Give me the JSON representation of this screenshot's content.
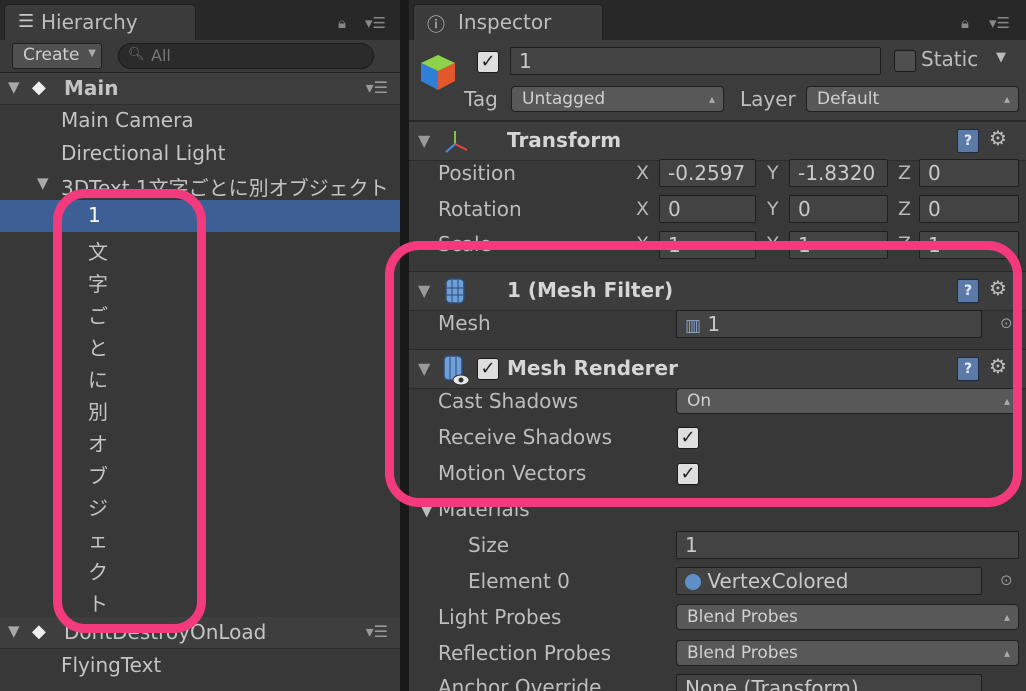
{
  "hierarchy": {
    "tab_label": "Hierarchy",
    "create_label": "Create",
    "search_placeholder": "All",
    "rows": [
      {
        "label": "Main"
      },
      {
        "label": "Main Camera"
      },
      {
        "label": "Directional Light"
      },
      {
        "label": "3DText 1文字ごとに別オブジェクト"
      },
      {
        "label": "1"
      },
      {
        "label": "文"
      },
      {
        "label": "字"
      },
      {
        "label": "ご"
      },
      {
        "label": "と"
      },
      {
        "label": "に"
      },
      {
        "label": "別"
      },
      {
        "label": "オ"
      },
      {
        "label": "ブ"
      },
      {
        "label": "ジ"
      },
      {
        "label": "ェ"
      },
      {
        "label": "ク"
      },
      {
        "label": "ト"
      },
      {
        "label": "DontDestroyOnLoad"
      },
      {
        "label": "FlyingText"
      }
    ]
  },
  "inspector": {
    "tab_label": "Inspector",
    "object_name": "1",
    "static_label": "Static",
    "tag_label": "Tag",
    "tag_value": "Untagged",
    "layer_label": "Layer",
    "layer_value": "Default",
    "transform": {
      "title": "Transform",
      "position_label": "Position",
      "rotation_label": "Rotation",
      "scale_label": "Scale",
      "position": {
        "x": "-0.2597",
        "y": "-1.8320",
        "z": "0"
      },
      "rotation": {
        "x": "0",
        "y": "0",
        "z": "0"
      },
      "scale": {
        "x": "1",
        "y": "1",
        "z": "1"
      }
    },
    "mesh_filter": {
      "title": "1 (Mesh Filter)",
      "mesh_label": "Mesh",
      "mesh_value": "1"
    },
    "mesh_renderer": {
      "title": "Mesh Renderer",
      "cast_shadows_label": "Cast Shadows",
      "cast_shadows_value": "On",
      "receive_shadows_label": "Receive Shadows",
      "motion_vectors_label": "Motion Vectors",
      "materials_label": "Materials",
      "size_label": "Size",
      "size_value": "1",
      "element0_label": "Element 0",
      "element0_value": "VertexColored",
      "light_probes_label": "Light Probes",
      "light_probes_value": "Blend Probes",
      "reflection_probes_label": "Reflection Probes",
      "reflection_probes_value": "Blend Probes",
      "anchor_override_label": "Anchor Override",
      "anchor_override_value": "None (Transform)"
    },
    "axis": {
      "x": "X",
      "y": "Y",
      "z": "Z"
    }
  },
  "colors": {
    "selection": "#3e5f96",
    "highlight": "#f33a7d",
    "panel": "#383838"
  }
}
